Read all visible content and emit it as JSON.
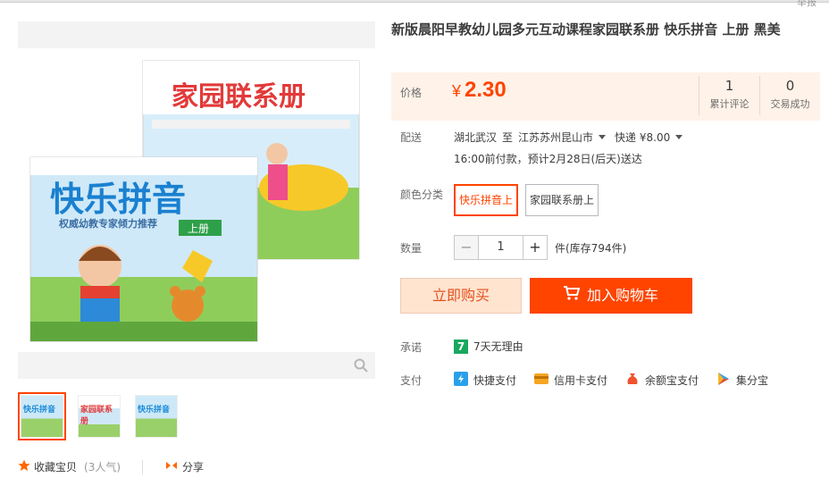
{
  "header": {
    "corner_text": "举报"
  },
  "product": {
    "title": "新版晨阳早教幼儿园多元互动课程家园联系册 快乐拼音 上册 黑美",
    "cover_texts": {
      "back_book": "家园联系册",
      "front_book": "快乐拼音",
      "volume": "上册",
      "subtitle": "权威幼教专家倾力推荐"
    }
  },
  "price": {
    "label": "价格",
    "currency": "¥",
    "value": "2.30"
  },
  "stats": [
    {
      "num": "1",
      "label": "累计评论"
    },
    {
      "num": "0",
      "label": "交易成功"
    }
  ],
  "shipping": {
    "label": "配送",
    "from": "湖北武汉",
    "to_word": "至",
    "to": "江苏苏州昆山市",
    "express": "快递 ¥8.00",
    "time_highlight": "16:00",
    "time_text": "前付款，预计2月28日(后天)送达"
  },
  "sku": {
    "label": "颜色分类",
    "options": [
      "快乐拼音上",
      "家园联系册上"
    ],
    "selected_index": 0
  },
  "quantity": {
    "label": "数量",
    "minus": "−",
    "value": "1",
    "plus": "+",
    "stock": "件(库存794件)"
  },
  "actions": {
    "buy_now": "立即购买",
    "add_to_cart": "加入购物车"
  },
  "promise": {
    "label": "承诺",
    "badge": "7",
    "text": "7天无理由"
  },
  "payment": {
    "label": "支付",
    "methods": [
      "快捷支付",
      "信用卡支付",
      "余额宝支付",
      "集分宝"
    ]
  },
  "social": {
    "favorite": "收藏宝贝",
    "popularity": "(3人气)",
    "share": "分享"
  },
  "thumbnails": [
    "快乐拼音",
    "家园联系册",
    "快乐拼音"
  ],
  "colors": {
    "accent": "#ff4400",
    "price": "#ff4400",
    "price_bg": "#fff2e8"
  }
}
